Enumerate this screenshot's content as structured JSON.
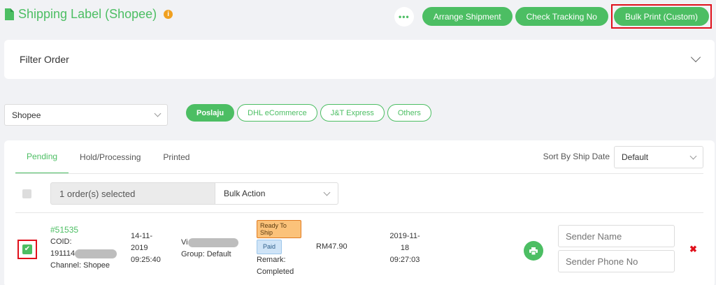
{
  "header": {
    "title": "Shipping Label (Shopee)",
    "info_icon": "i",
    "more_label": "•••",
    "buttons": {
      "arrange": "Arrange Shipment",
      "tracking": "Check Tracking No",
      "bulk_print": "Bulk Print (Custom)"
    }
  },
  "filter": {
    "label": "Filter Order"
  },
  "channel_select": {
    "value": "Shopee"
  },
  "carriers": [
    {
      "label": "Poslaju",
      "active": true
    },
    {
      "label": "DHL eCommerce",
      "active": false
    },
    {
      "label": "J&T Express",
      "active": false
    },
    {
      "label": "Others",
      "active": false
    }
  ],
  "status_tabs": [
    {
      "label": "Pending",
      "active": true
    },
    {
      "label": "Hold/Processing",
      "active": false
    },
    {
      "label": "Printed",
      "active": false
    }
  ],
  "sort": {
    "label": "Sort By Ship Date",
    "value": "Default"
  },
  "bulk": {
    "selected_text": "1 order(s) selected",
    "action_label": "Bulk Action"
  },
  "order": {
    "id": "#51535",
    "coid_label": "COID:",
    "coid_prefix": "191114",
    "channel_label": "Channel:",
    "channel_value": "Shopee",
    "date_line1": "14-11-",
    "date_line2": "2019",
    "date_line3": "09:25:40",
    "buyer_prefix": "Vi",
    "group_label": "Group:",
    "group_value": "Default",
    "status_badge": "Ready To Ship",
    "payment_badge": "Paid",
    "remark_label": "Remark:",
    "remark_value": "Completed",
    "amount": "RM47.90",
    "ship_line1": "2019-11-",
    "ship_line2": "18",
    "ship_line3": "09:27:03",
    "sender_name_placeholder": "Sender Name",
    "sender_phone_placeholder": "Sender Phone No",
    "delete_glyph": "✖"
  },
  "colors": {
    "accent": "#4cbe63",
    "highlight": "#e0101b",
    "info": "#f0a020"
  }
}
